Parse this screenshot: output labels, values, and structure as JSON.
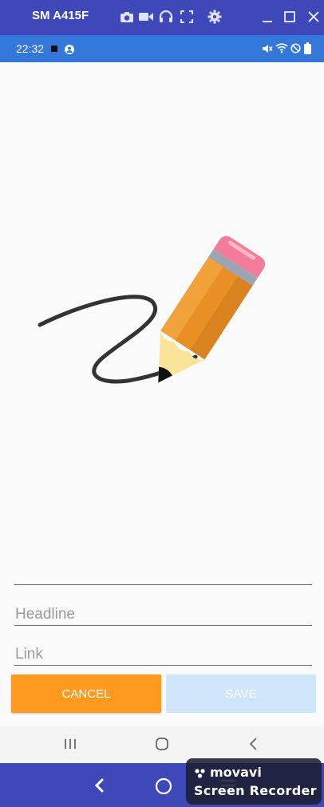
{
  "window": {
    "title": "SM A415F",
    "icons": [
      "camera-icon",
      "video-icon",
      "headphones-icon",
      "fullscreen-icon",
      "settings-icon",
      "minimize-icon",
      "maximize-icon",
      "close-icon"
    ]
  },
  "status_bar": {
    "time": "22:32",
    "icons": [
      "media-icon",
      "account-icon",
      "mute-icon",
      "wifi-icon",
      "dnd-icon",
      "battery-icon"
    ]
  },
  "illustration": {
    "name": "pencil-drawing-illustration",
    "colors": {
      "pencil_body": "#f2a23a",
      "pencil_stripe": "#e08a1e",
      "eraser": "#f47b9a",
      "ferrule": "#9fa4b3",
      "wood": "#fbe39a",
      "line": "#333333"
    }
  },
  "form": {
    "field_top": {
      "value": ""
    },
    "headline": {
      "placeholder": "Headline"
    },
    "link": {
      "placeholder": "Link"
    }
  },
  "buttons": {
    "cancel": "CANCEL",
    "save": "SAVE",
    "colors": {
      "cancel_bg": "#ff9a1f",
      "save_bg": "#cfe5fa"
    }
  },
  "nav_bar": {
    "icons": [
      "recents-icon",
      "home-icon",
      "back-icon"
    ]
  },
  "host_bar": {
    "icons": [
      "host-back-icon",
      "host-home-icon",
      "host-menu-icon"
    ]
  },
  "watermark": {
    "brand": "movavi",
    "product": "Screen Recorder"
  }
}
